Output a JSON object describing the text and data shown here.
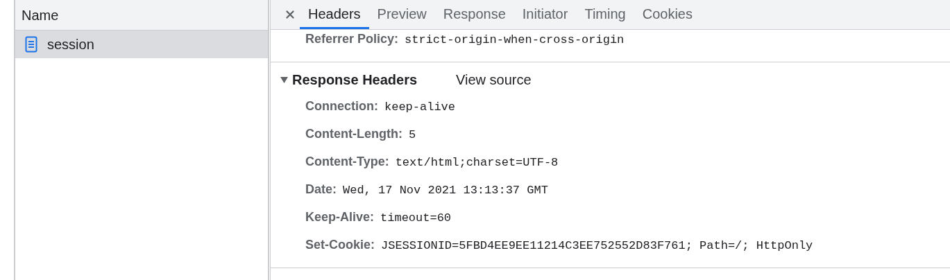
{
  "request_list": {
    "column_header": "Name",
    "rows": [
      {
        "name": "session",
        "selected": true
      }
    ]
  },
  "tabs": [
    {
      "label": "Headers",
      "selected": true
    },
    {
      "label": "Preview",
      "selected": false
    },
    {
      "label": "Response",
      "selected": false
    },
    {
      "label": "Initiator",
      "selected": false
    },
    {
      "label": "Timing",
      "selected": false
    },
    {
      "label": "Cookies",
      "selected": false
    }
  ],
  "general_tail": [
    {
      "name": "Referrer Policy:",
      "value": "strict-origin-when-cross-origin"
    }
  ],
  "response_headers": {
    "title": "Response Headers",
    "expanded": true,
    "view_source": "View source",
    "headers": [
      {
        "name": "Connection:",
        "value": "keep-alive"
      },
      {
        "name": "Content-Length:",
        "value": "5"
      },
      {
        "name": "Content-Type:",
        "value": "text/html;charset=UTF-8"
      },
      {
        "name": "Date:",
        "value": "Wed, 17 Nov 2021 13:13:37 GMT"
      },
      {
        "name": "Keep-Alive:",
        "value": "timeout=60"
      },
      {
        "name": "Set-Cookie:",
        "value": "JSESSIONID=5FBD4EE9EE11214C3EE752552D83F761; Path=/; HttpOnly"
      }
    ]
  }
}
